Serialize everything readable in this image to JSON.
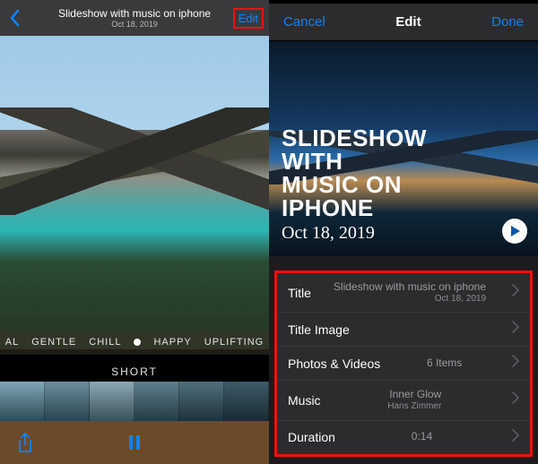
{
  "left": {
    "header": {
      "title": "Slideshow with music on iphone",
      "subtitle": "Oct 18, 2019",
      "edit": "Edit"
    },
    "moods": [
      "AL",
      "GENTLE",
      "CHILL",
      "HAPPY",
      "UPLIFTING"
    ],
    "short_label": "SHORT"
  },
  "right": {
    "header": {
      "cancel": "Cancel",
      "title": "Edit",
      "done": "Done"
    },
    "hero": {
      "title_line1": "SLIDESHOW WITH",
      "title_line2": "MUSIC ON IPHONE",
      "date": "Oct 18, 2019"
    },
    "rows": {
      "title": {
        "label": "Title",
        "value": "Slideshow with music on iphone",
        "sub": "Oct 18, 2019"
      },
      "title_image": {
        "label": "Title Image",
        "value": ""
      },
      "photos": {
        "label": "Photos & Videos",
        "value": "6 Items"
      },
      "music": {
        "label": "Music",
        "value": "Inner Glow",
        "sub": "Hans Zimmer"
      },
      "duration": {
        "label": "Duration",
        "value": "0:14"
      }
    }
  }
}
